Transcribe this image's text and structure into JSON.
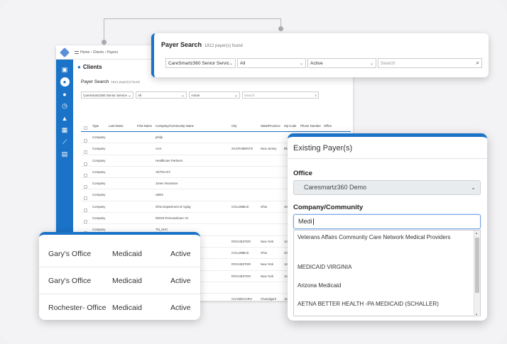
{
  "app": {
    "breadcrumb": "Home › Clients › Payers",
    "section_title": "Clients",
    "payer_search_label": "Payer Search",
    "payer_count": "1812 payer(s) found",
    "filters": [
      "CareSmartz360 Senior Service",
      "All",
      "Active",
      "Search"
    ],
    "columns": [
      "Type",
      "Last Name",
      "First Name",
      "Company/Community Name",
      "City",
      "State/Province",
      "Zip Code",
      "Phone Number",
      "Office"
    ],
    "rows": [
      {
        "type": "Company",
        "name": "philip",
        "city": "",
        "state": "",
        "zip": ""
      },
      {
        "type": "Company",
        "name": "AAA",
        "city": "SACRAMENTO",
        "state": "New Jersey",
        "zip": "95"
      },
      {
        "type": "Company",
        "name": "Healthcare Partners",
        "city": "",
        "state": "",
        "zip": ""
      },
      {
        "type": "Company",
        "name": "AETNA NY",
        "city": "",
        "state": "",
        "zip": ""
      },
      {
        "type": "Company",
        "name": "Jones Insurance",
        "city": "",
        "state": "",
        "zip": ""
      },
      {
        "type": "Company",
        "name": "UB04",
        "city": "",
        "state": "",
        "zip": ""
      },
      {
        "type": "Company",
        "name": "Ohio Department of Aging",
        "city": "COLUMBUS",
        "state": "Ohio",
        "zip": "43"
      },
      {
        "type": "Company",
        "name": "DDSN-PersonalCare VA",
        "city": "",
        "state": "",
        "zip": ""
      },
      {
        "type": "Company",
        "name": "TN_UHC",
        "city": "",
        "state": "",
        "zip": ""
      },
      {
        "type": "",
        "name": "",
        "city": "ROCHESTER",
        "state": "New York",
        "zip": "14"
      },
      {
        "type": "",
        "name": "",
        "city": "COLUMBUS",
        "state": "Ohio",
        "zip": "43"
      },
      {
        "type": "",
        "name": "",
        "city": "ROCHESTER",
        "state": "New York",
        "zip": "14"
      },
      {
        "type": "",
        "name": "d",
        "city": "ROCHESTER",
        "state": "New York",
        "zip": "14"
      },
      {
        "type": "",
        "name": "",
        "city": "",
        "state": "",
        "zip": ""
      },
      {
        "type": "",
        "name": "",
        "city": "CHANDIGARH",
        "state": "Chandigarh",
        "zip": "16"
      }
    ]
  },
  "payer_card": {
    "title": "Payer Search",
    "count": "1812 payer(s) found",
    "company_filter": "CareSmartz360 Senior Service",
    "type_filter": "All",
    "status_filter": "Active",
    "search_placeholder": "Search"
  },
  "offices": [
    {
      "office": "Gary's Office",
      "payer": "Medicaid",
      "status": "Active"
    },
    {
      "office": "Gary's Office",
      "payer": "Medicaid",
      "status": "Active"
    },
    {
      "office": "Rochester- Office",
      "payer": "Medicaid",
      "status": "Active"
    }
  ],
  "existing": {
    "title": "Existing Payer(s)",
    "office_label": "Office",
    "office_value": "Caresmartz360 Demo",
    "company_label": "Company/Community",
    "company_value": "Medi",
    "options": [
      "Veterans Affairs Community Care Network Medical Providers",
      "MEDICAID VIRGINIA",
      "Arizona Medicaid",
      "AETNA BETTER HEALTH -PA MEDICAID (SCHALLER)"
    ]
  },
  "colors": {
    "accent": "#1b73c8",
    "background": "#f3f3f5"
  },
  "icons": [
    "home-icon",
    "user-icon",
    "clock-icon",
    "flask-icon",
    "chart-icon",
    "report-icon",
    "search-icon",
    "chevron-down-icon"
  ]
}
